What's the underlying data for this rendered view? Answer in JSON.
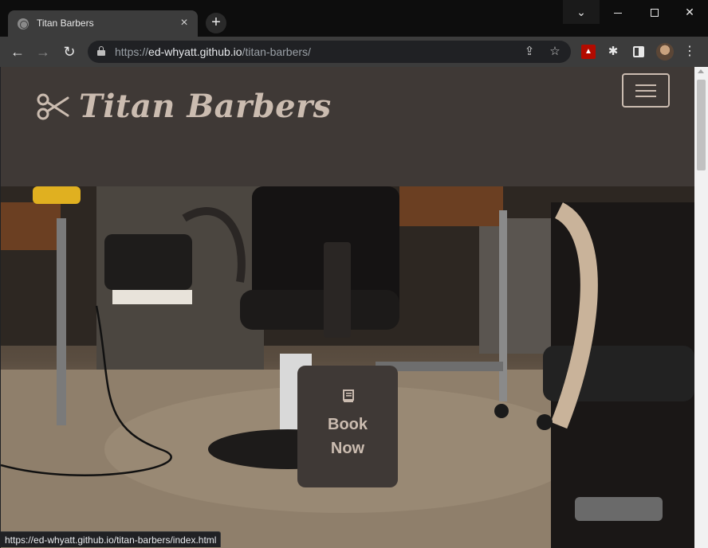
{
  "browser": {
    "tab": {
      "title": "Titan Barbers",
      "close_glyph": "×"
    },
    "new_tab_glyph": "+",
    "window_controls": {
      "dropdown_glyph": "⌄",
      "close_glyph": "✕"
    },
    "nav": {
      "back_glyph": "←",
      "forward_glyph": "→",
      "reload_glyph": "↻"
    },
    "omnibox": {
      "scheme": "https://",
      "host": "ed-whyatt.github.io",
      "path": "/titan-barbers/"
    },
    "icons": {
      "share_glyph": "⇪",
      "star_glyph": "☆",
      "puzzle_glyph": "✱",
      "menu_glyph": "⋮"
    },
    "status_url": "https://ed-whyatt.github.io/titan-barbers/index.html"
  },
  "site": {
    "brand_name": "Titan Barbers",
    "book_line1": "Book",
    "book_line2": "Now"
  },
  "colors": {
    "header_bg": "#3f3936",
    "accent_text": "#cbbcb0"
  }
}
